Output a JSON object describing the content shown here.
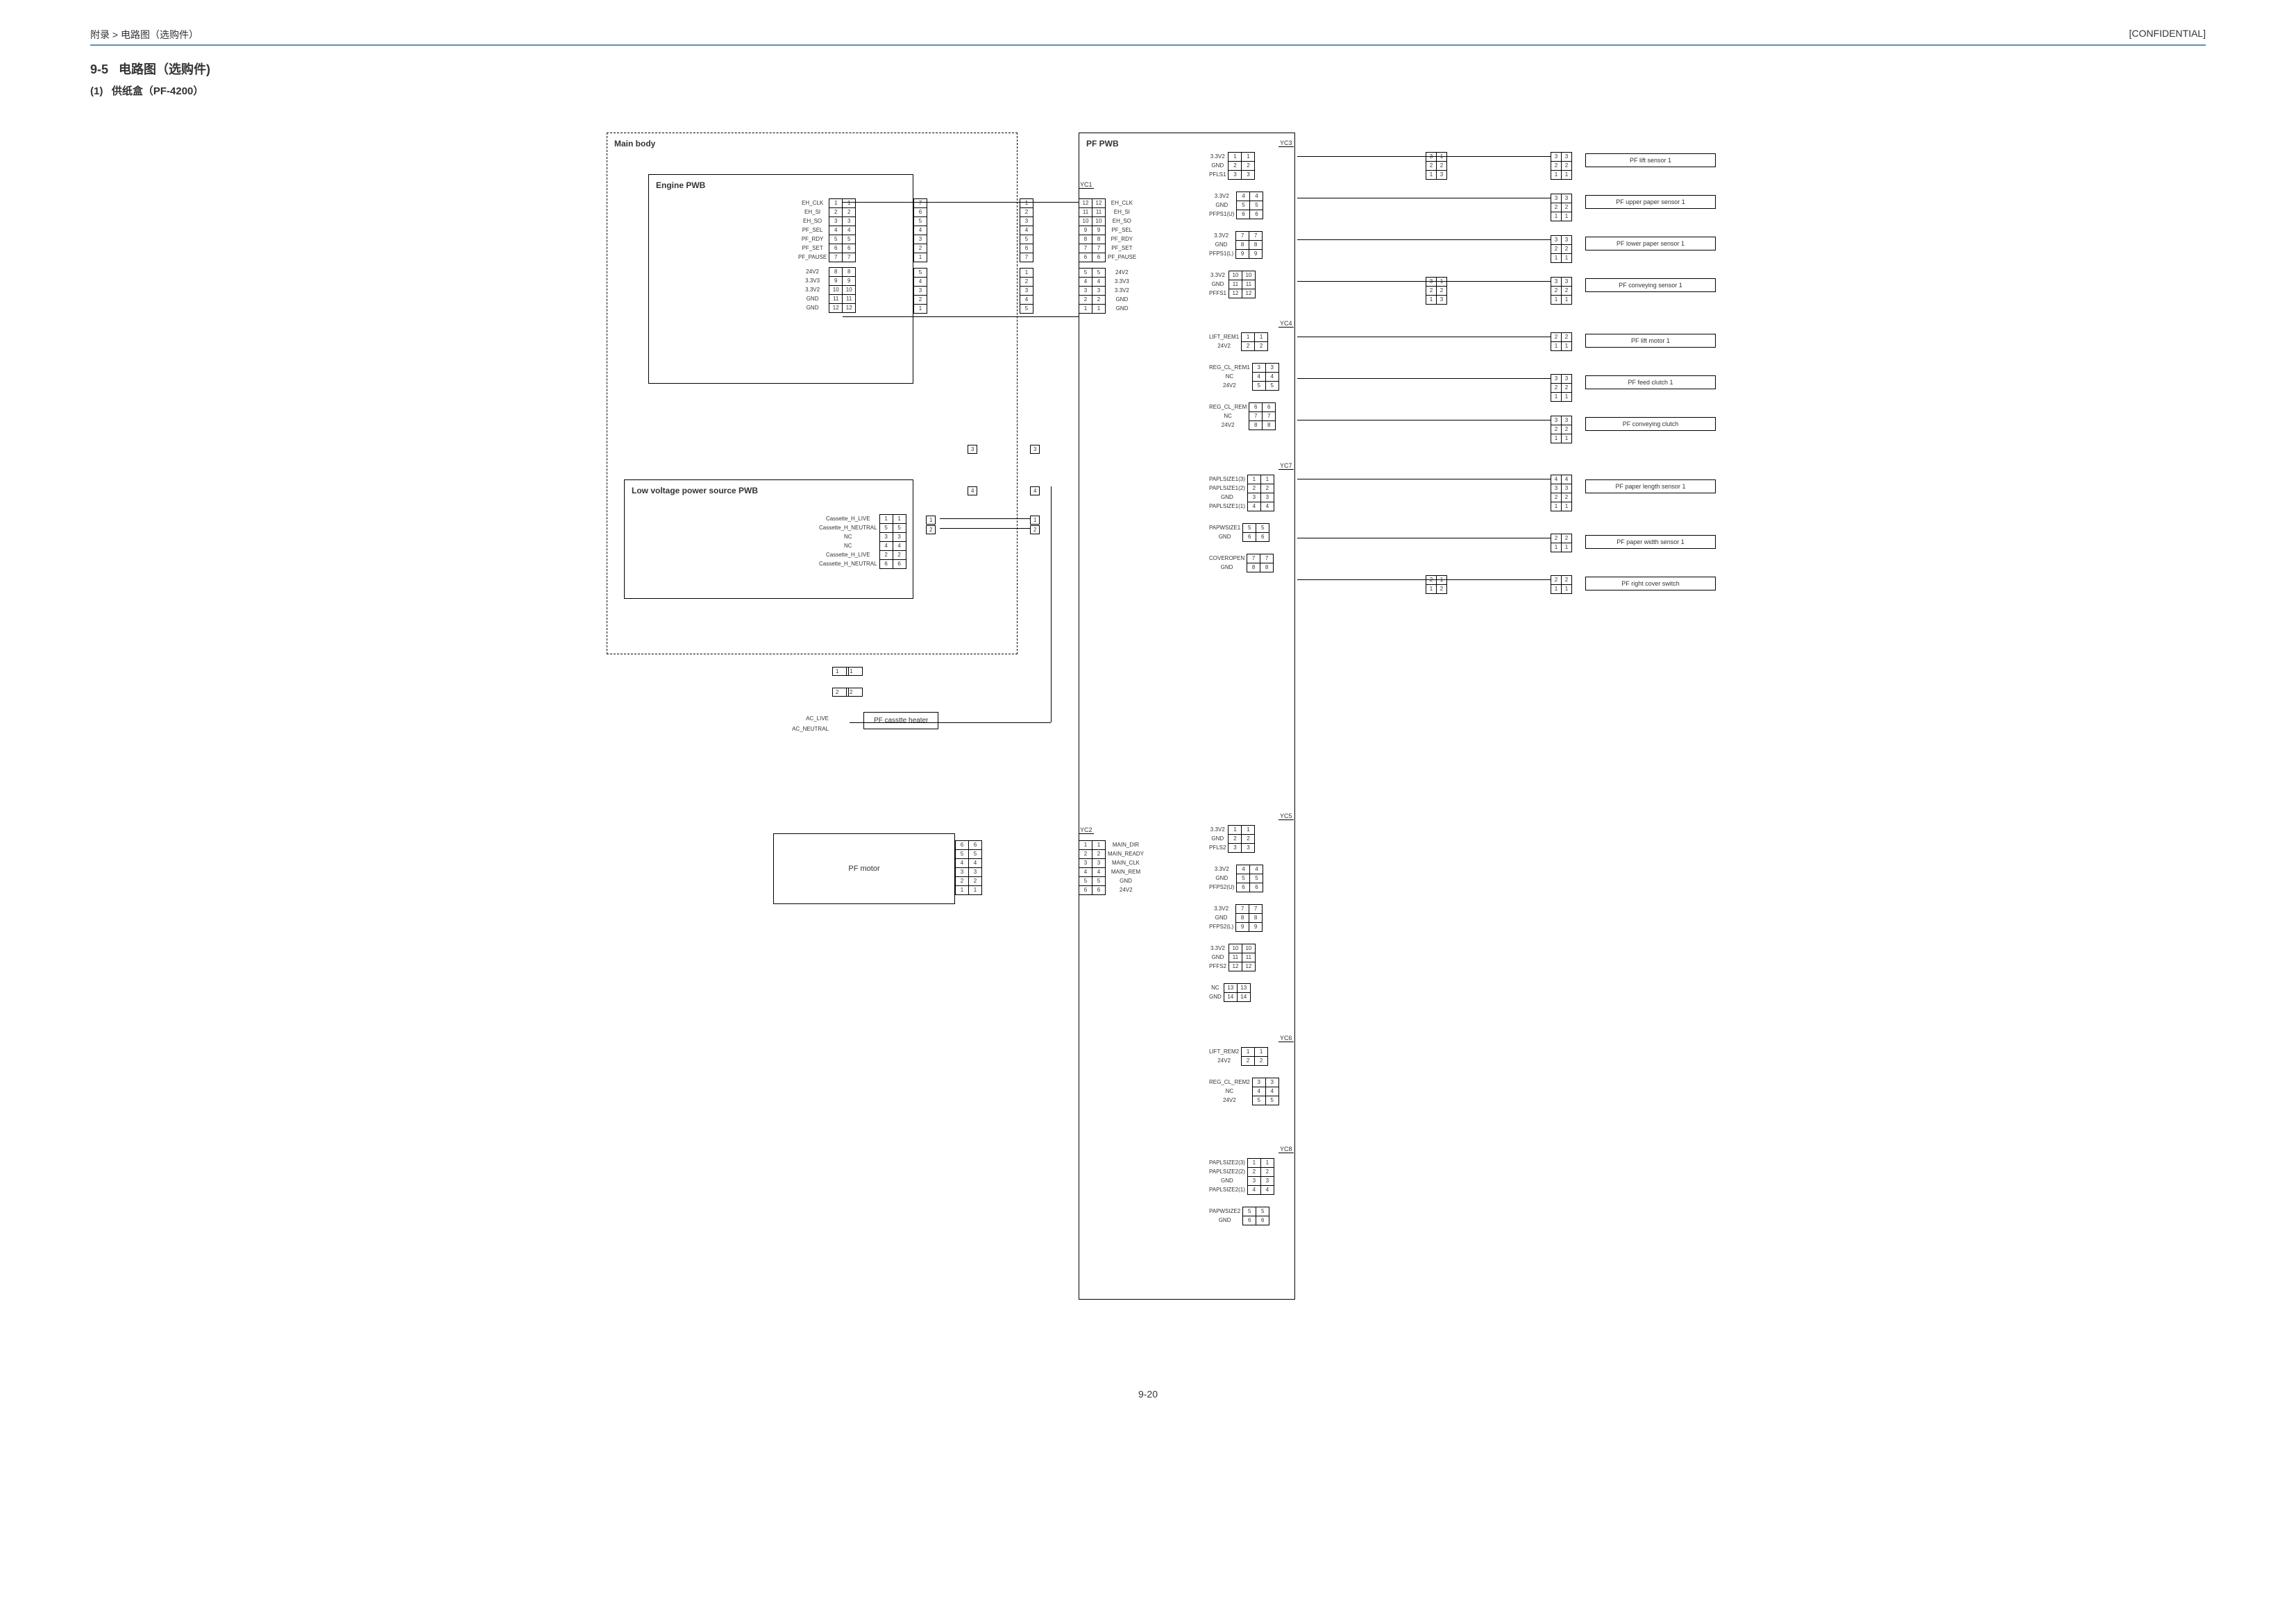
{
  "header": {
    "breadcrumb": "附录 > 电路图（选购件）",
    "confidential": "[CONFIDENTIAL]"
  },
  "section": {
    "number": "9-5",
    "title": "电路图（选购件)",
    "sub_number": "(1)",
    "sub_title": "供纸盒（PF-4200）"
  },
  "blocks": {
    "main_body": "Main body",
    "engine_pwb": "Engine PWB",
    "low_voltage": "Low voltage power source PWB",
    "pf_pwb": "PF PWB",
    "pf_motor": "PF motor",
    "heater": "PF casstte heater",
    "ac_live": "AC_LIVE",
    "ac_neutral": "AC_NEUTRAL"
  },
  "yc": {
    "yc1": "YC1",
    "yc2": "YC2",
    "yc3": "YC3",
    "yc4": "YC4",
    "yc5": "YC5",
    "yc6": "YC6",
    "yc7": "YC7",
    "yc8": "YC8"
  },
  "engine_pins": [
    "EH_CLK",
    "EH_SI",
    "EH_SO",
    "PF_SEL",
    "PF_RDY",
    "PF_SET",
    "PF_PAUSE",
    "",
    "24V2",
    "3.3V3",
    "3.3V2",
    "GND",
    "GND"
  ],
  "engine_nums_l": [
    "1",
    "2",
    "3",
    "4",
    "5",
    "6",
    "7",
    "",
    "8",
    "9",
    "10",
    "11",
    "12"
  ],
  "engine_nums_r": [
    "7",
    "6",
    "5",
    "4",
    "3",
    "2",
    "1",
    "",
    "5",
    "4",
    "3",
    "2",
    "1"
  ],
  "lv_pins": [
    "Cassette_H_LIVE",
    "Cassette_H_NEUTRAL",
    "NC",
    "NC",
    "Cassette_H_LIVE",
    "Cassette_H_NEUTRAL"
  ],
  "lv_nums": [
    "1",
    "5",
    "3",
    "4",
    "2",
    "6"
  ],
  "yc1_pins": [
    "EH_CLK",
    "EH_SI",
    "EH_SO",
    "PF_SEL",
    "PF_RDY",
    "PF_SET",
    "PF_PAUSE",
    "",
    "24V2",
    "3.3V3",
    "3.3V2",
    "GND",
    "GND"
  ],
  "yc1_nums_l": [
    "12",
    "11",
    "10",
    "9",
    "8",
    "7",
    "6",
    "",
    "5",
    "4",
    "3",
    "2",
    "1"
  ],
  "yc2_pins": [
    "MAIN_DIR",
    "MAIN_READY",
    "MAIN_CLK",
    "MAIN_REM",
    "GND",
    "24V2"
  ],
  "yc2_nums": [
    "1",
    "2",
    "3",
    "4",
    "5",
    "6"
  ],
  "yc3_groups": [
    {
      "labels": [
        "3.3V2",
        "GND",
        "PFLS1"
      ],
      "nums": [
        "1",
        "2",
        "3"
      ]
    },
    {
      "labels": [
        "3.3V2",
        "GND",
        "PFPS1(U)"
      ],
      "nums": [
        "4",
        "5",
        "6"
      ]
    },
    {
      "labels": [
        "3.3V2",
        "GND",
        "PFPS1(L)"
      ],
      "nums": [
        "7",
        "8",
        "9"
      ]
    },
    {
      "labels": [
        "3.3V2",
        "GND",
        "PFFS1"
      ],
      "nums": [
        "10",
        "11",
        "12"
      ]
    }
  ],
  "yc4_groups": [
    {
      "labels": [
        "LIFT_REM1",
        "24V2"
      ],
      "nums": [
        "1",
        "2"
      ]
    },
    {
      "labels": [
        "REG_CL_REM1",
        "NC",
        "24V2"
      ],
      "nums": [
        "3",
        "4",
        "5"
      ]
    },
    {
      "labels": [
        "REG_CL_REM",
        "NC",
        "24V2"
      ],
      "nums": [
        "6",
        "7",
        "8"
      ]
    }
  ],
  "yc7_groups": [
    {
      "labels": [
        "PAPLSIZE1(3)",
        "PAPLSIZE1(2)",
        "GND",
        "PAPLSIZE1(1)"
      ],
      "nums": [
        "1",
        "2",
        "3",
        "4"
      ]
    },
    {
      "labels": [
        "PAPWSIZE1",
        "GND"
      ],
      "nums": [
        "5",
        "6"
      ]
    },
    {
      "labels": [
        "COVEROPEN",
        "GND"
      ],
      "nums": [
        "7",
        "8"
      ]
    }
  ],
  "yc5_groups": [
    {
      "labels": [
        "3.3V2",
        "GND",
        "PFLS2"
      ],
      "nums": [
        "1",
        "2",
        "3"
      ]
    },
    {
      "labels": [
        "3.3V2",
        "GND",
        "PFPS2(U)"
      ],
      "nums": [
        "4",
        "5",
        "6"
      ]
    },
    {
      "labels": [
        "3.3V2",
        "GND",
        "PFPS2(L)"
      ],
      "nums": [
        "7",
        "8",
        "9"
      ]
    },
    {
      "labels": [
        "3.3V2",
        "GND",
        "PFFS2"
      ],
      "nums": [
        "10",
        "11",
        "12"
      ]
    },
    {
      "labels": [
        "NC",
        "GND"
      ],
      "nums": [
        "13",
        "14"
      ]
    }
  ],
  "yc6_groups": [
    {
      "labels": [
        "LIFT_REM2",
        "24V2"
      ],
      "nums": [
        "1",
        "2"
      ]
    },
    {
      "labels": [
        "REG_CL_REM2",
        "NC",
        "24V2"
      ],
      "nums": [
        "3",
        "4",
        "5"
      ]
    }
  ],
  "yc8_groups": [
    {
      "labels": [
        "PAPLSIZE2(3)",
        "PAPLSIZE2(2)",
        "GND",
        "PAPLSIZE2(1)"
      ],
      "nums": [
        "1",
        "2",
        "3",
        "4"
      ]
    },
    {
      "labels": [
        "PAPWSIZE2",
        "GND"
      ],
      "nums": [
        "5",
        "6"
      ]
    }
  ],
  "sensors": {
    "s1": "PF lift sensor 1",
    "s2": "PF upper paper sensor 1",
    "s3": "PF lower paper sensor 1",
    "s4": "PF conveying sensor 1",
    "s5": "PF lift motor 1",
    "s6": "PF feed clutch 1",
    "s7": "PF conveying clutch",
    "s8": "PF paper length sensor 1",
    "s9": "PF paper width sensor 1",
    "s10": "PF right cover switch"
  },
  "mid_conn": {
    "a": "1",
    "b": "2",
    "c": "3",
    "d": "4"
  },
  "motor_nums": [
    "6",
    "5",
    "4",
    "3",
    "2",
    "1"
  ],
  "footer": {
    "page": "9-20"
  }
}
